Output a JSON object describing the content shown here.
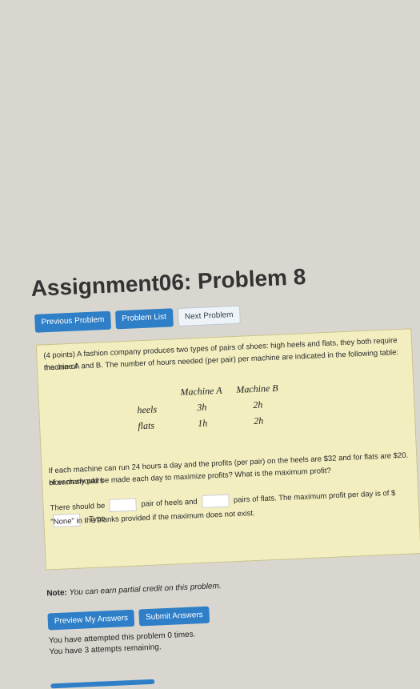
{
  "title": "Assignment06: Problem 8",
  "nav": {
    "previous": "Previous Problem",
    "list": "Problem List",
    "next": "Next Problem"
  },
  "problem": {
    "intro_line1": "(4 points) A fashion company produces two types of pairs of shoes: high heels and flats, they both require the use of",
    "intro_line2": "machine A and B. The number of hours needed (per pair) per machine are indicated in the following table:",
    "table": {
      "headers": [
        "Machine A",
        "Machine B"
      ],
      "rows": [
        {
          "label": "heels",
          "a": "3h",
          "b": "2h"
        },
        {
          "label": "flats",
          "a": "1h",
          "b": "2h"
        }
      ]
    },
    "question_line1": "If each machine can run 24 hours a day and the profits (per pair) on the heels are $32 and for flats are $20. How many pairs",
    "question_line2": "of each should be made each day to maximize profits? What is the maximum profit?",
    "answer_a": "There should be",
    "answer_b": "pair of heels and",
    "answer_c": "pairs of flats. The maximum profit per day is of $",
    "answer_d": ". Type",
    "none_hint": "\"None\" in the blanks provided if the maximum does not exist."
  },
  "note_label": "Note:",
  "note_text": "You can earn partial credit on this problem.",
  "actions": {
    "preview": "Preview My Answers",
    "submit": "Submit Answers"
  },
  "attempts": {
    "line1": "You have attempted this problem 0 times.",
    "line2": "You have 3 attempts remaining."
  }
}
